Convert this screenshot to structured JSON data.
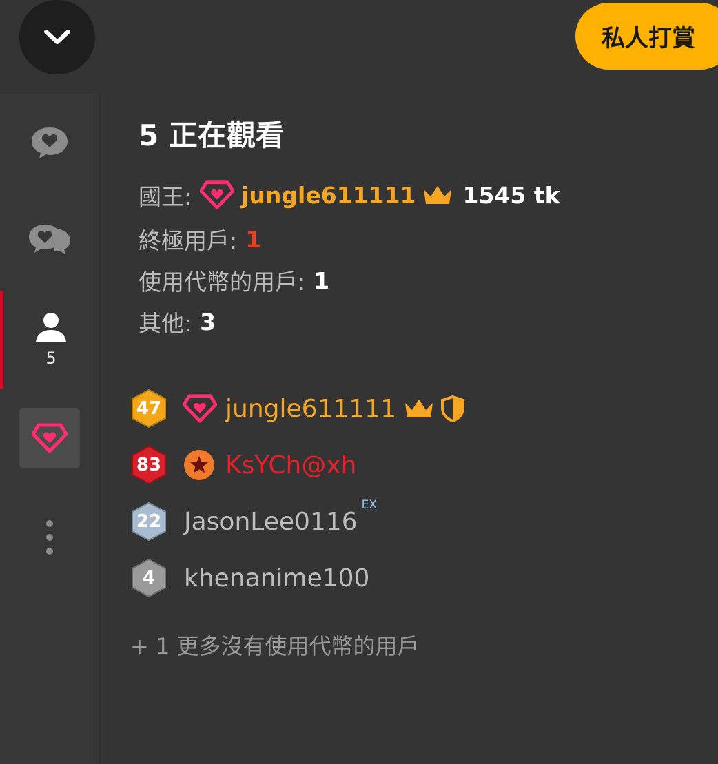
{
  "header": {
    "collapse_icon": "chevron-down-icon",
    "tip_button_label": "私人打賞"
  },
  "sidebar": {
    "items": [
      {
        "icon": "chat-heart-icon"
      },
      {
        "icon": "group-chat-heart-icon"
      },
      {
        "icon": "user-icon",
        "count": "5",
        "active": true
      },
      {
        "icon": "diamond-heart-icon"
      },
      {
        "icon": "more-vertical-icon"
      }
    ],
    "active_color": "#d80d2a"
  },
  "main": {
    "title": "5 正在觀看",
    "king_label": "國王:",
    "king_name": "jungle611111",
    "king_tokens": "1545 tk",
    "ultimate_label": "終極用戶:",
    "ultimate_count": "1",
    "token_users_label": "使用代幣的用戶:",
    "token_users_count": "1",
    "others_label": "其他:",
    "others_count": "3",
    "users": [
      {
        "level": "47",
        "name": "jungle611111",
        "badge_color": "#f3a617"
      },
      {
        "level": "83",
        "name": "KsYCh@xh",
        "badge_color": "#d8202a"
      },
      {
        "level": "22",
        "name": "JasonLee0116",
        "tag": "EX",
        "badge_color": "#a9bccf"
      },
      {
        "level": "4",
        "name": "khenanime100",
        "badge_color": "#9a9a9a"
      }
    ],
    "more_text": "+ 1 更多沒有使用代幣的用戶"
  },
  "colors": {
    "accent_yellow": "#ffb100",
    "gold_text": "#f6a623",
    "red_text": "#e8202a",
    "pink_icon": "#ff2e6e"
  }
}
